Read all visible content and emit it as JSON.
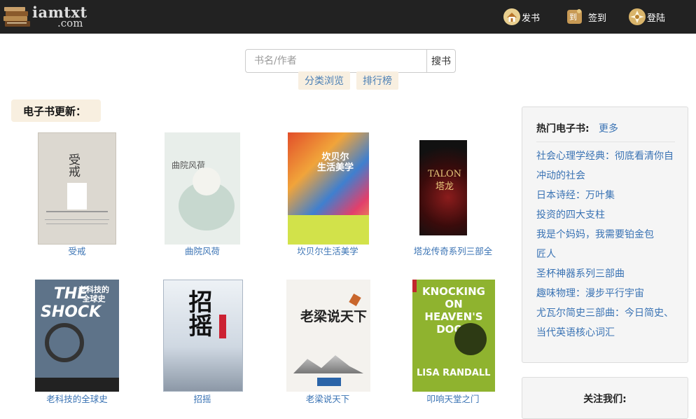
{
  "header": {
    "logo_line1": "iamtxt",
    "logo_line2": ".com",
    "nav": [
      {
        "label": "发书",
        "icon": "home-icon"
      },
      {
        "label": "签到",
        "icon": "checkin-icon",
        "badge": "到"
      },
      {
        "label": "登陆",
        "icon": "login-icon"
      }
    ]
  },
  "search": {
    "placeholder": "书名/作者",
    "button_label": "搜书"
  },
  "links": {
    "browse": "分类浏览",
    "ranking": "排行榜"
  },
  "updates": {
    "title": "电子书更新："
  },
  "books": [
    {
      "title": "受戒",
      "cover_text": "受戒",
      "bg": "#d8d4cc"
    },
    {
      "title": "曲院风荷",
      "cover_text": "曲院风荷",
      "bg": "#e6ece8"
    },
    {
      "title": "坎贝尔生活美学",
      "cover_text": "坎贝尔\n生活美学",
      "bg": "#d9502a"
    },
    {
      "title": "塔龙传奇系列三部全",
      "cover_text": "TALON\n塔龙",
      "bg": "#1a1a1a"
    },
    {
      "title": "老科技的全球史",
      "cover_text": "老科技的\n全球史",
      "bg": "#5b6f86"
    },
    {
      "title": "招摇",
      "cover_text": "招摇",
      "bg": "#dfe6ee"
    },
    {
      "title": "老梁说天下",
      "cover_text": "老梁说天下",
      "bg": "#f4f2ee"
    },
    {
      "title": "叩响天堂之门",
      "cover_text": "KNOCKING ON HEAVEN'S DOOR",
      "bg": "#8fb32f"
    }
  ],
  "hot": {
    "title": "热门电子书:",
    "more": "更多",
    "items": [
      "社会心理学经典：彻底看清你自",
      "冲动的社会",
      "日本诗经：万叶集",
      "投资的四大支柱",
      "我是个妈妈，我需要铂金包",
      "匠人",
      "圣杯神器系列三部曲",
      "趣味物理：漫步平行宇宙",
      "尤瓦尔简史三部曲：今日简史、",
      "当代英语核心词汇"
    ]
  },
  "follow": {
    "title": "关注我们:"
  }
}
